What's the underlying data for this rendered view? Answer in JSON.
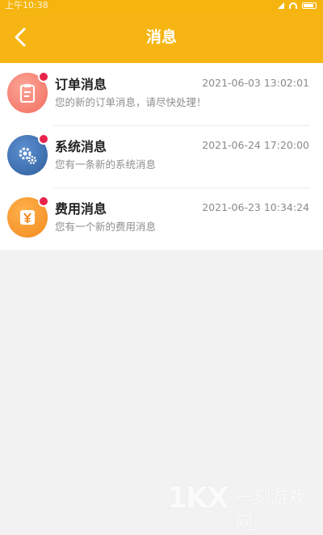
{
  "status_bar": {
    "time": "上午10:38"
  },
  "header": {
    "title": "消息"
  },
  "messages": [
    {
      "title": "订单消息",
      "text": "您的新的订单消息，请尽快处理！",
      "time": "2021-06-03 13:02:01",
      "icon": "clipboard-icon",
      "color": "#f57f6e"
    },
    {
      "title": "系统消息",
      "text": "您有一条新的系统消息",
      "time": "2021-06-24 17:20:00",
      "icon": "gears-icon",
      "color": "#3b6fb0"
    },
    {
      "title": "费用消息",
      "text": "您有一个新的费用消息",
      "time": "2021-06-23 10:34:24",
      "icon": "yen-icon",
      "color": "#f79a2e"
    }
  ],
  "watermark": {
    "brand": "1KX",
    "name": "一刻游戏网",
    "url": "www.1kyx.com"
  }
}
